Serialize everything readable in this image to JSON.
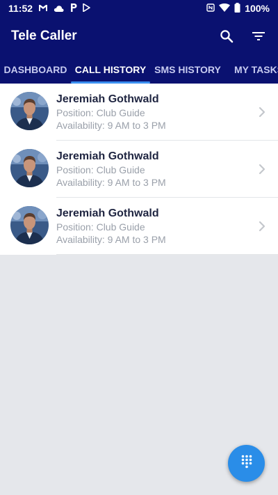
{
  "status_bar": {
    "time": "11:52",
    "battery": "100%",
    "left_icons": [
      "gmail-icon",
      "cloud-icon",
      "p-icon",
      "play-store-icon"
    ],
    "right_icons": [
      "nfc-icon",
      "wifi-icon",
      "battery-icon"
    ]
  },
  "app_bar": {
    "title": "Tele Caller",
    "actions": [
      "search-icon",
      "filter-icon"
    ]
  },
  "tabs": [
    {
      "label": "DASHBOARD",
      "active": false
    },
    {
      "label": "CALL HISTORY",
      "active": true
    },
    {
      "label": "SMS HISTORY",
      "active": false
    },
    {
      "label": "MY TASKS",
      "active": false
    }
  ],
  "contacts": [
    {
      "name": "Jeremiah Gothwald",
      "position": "Position: Club Guide",
      "availability": "Availability: 9 AM to 3 PM"
    },
    {
      "name": "Jeremiah Gothwald",
      "position": "Position: Club Guide",
      "availability": "Availability: 9 AM to 3 PM"
    },
    {
      "name": "Jeremiah Gothwald",
      "position": "Position: Club Guide",
      "availability": "Availability: 9 AM to 3 PM"
    }
  ],
  "fab": {
    "icon": "dialpad-icon"
  },
  "colors": {
    "primary": "#0a1170",
    "accent": "#2a8de8",
    "background": "#e5e7eb",
    "name_text": "#1f2541",
    "secondary_text": "#9aa0aa"
  }
}
